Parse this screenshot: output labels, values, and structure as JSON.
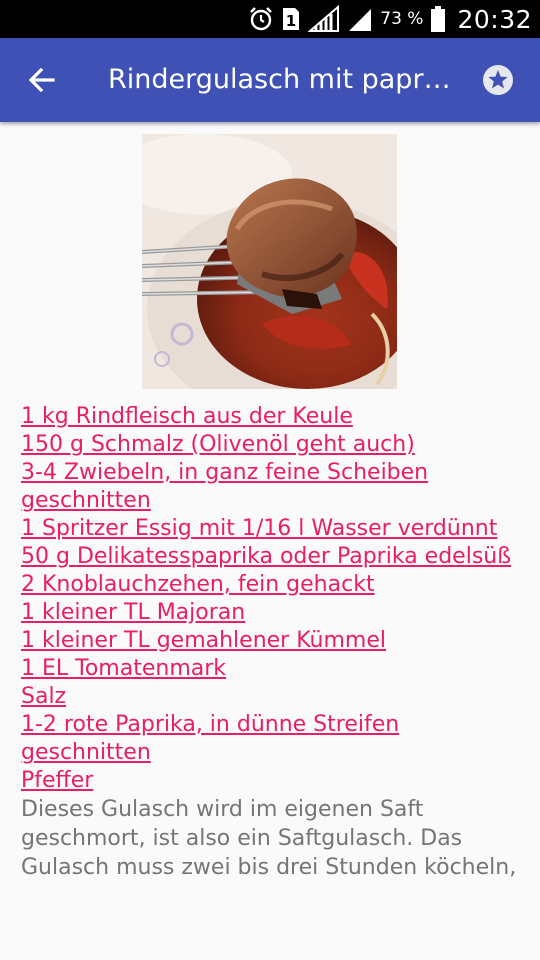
{
  "status_bar": {
    "battery_percent": "73 %",
    "time": "20:32",
    "sim_label": "1"
  },
  "app_bar": {
    "title": "Rindergulasch mit paprika",
    "back_icon": "arrow-left-icon",
    "favorite_icon": "star-icon"
  },
  "recipe": {
    "ingredients": [
      "1 kg Rindfleisch aus der Keule",
      "150 g Schmalz (Olivenöl geht auch)",
      "3-4 Zwiebeln, in ganz feine Scheiben geschnitten",
      "1 Spritzer Essig mit 1/16 l Wasser verdünnt",
      "50 g Delikatesspaprika oder Paprika edelsüß",
      "2 Knoblauchzehen, fein gehackt",
      "1 kleiner TL Majoran",
      "1 kleiner TL gemahlener Kümmel",
      "1 EL Tomatenmark",
      "Salz",
      "1-2 rote Paprika, in dünne Streifen geschnitten",
      "Pfeffer"
    ],
    "description": "Dieses Gulasch wird im eigenen Saft geschmort, ist also ein Saftgulasch. Das Gulasch muss zwei bis drei Stunden köcheln,"
  },
  "colors": {
    "app_bar": "#3f51b5",
    "ingredient_link": "#e91e63",
    "description_text": "#757575"
  }
}
